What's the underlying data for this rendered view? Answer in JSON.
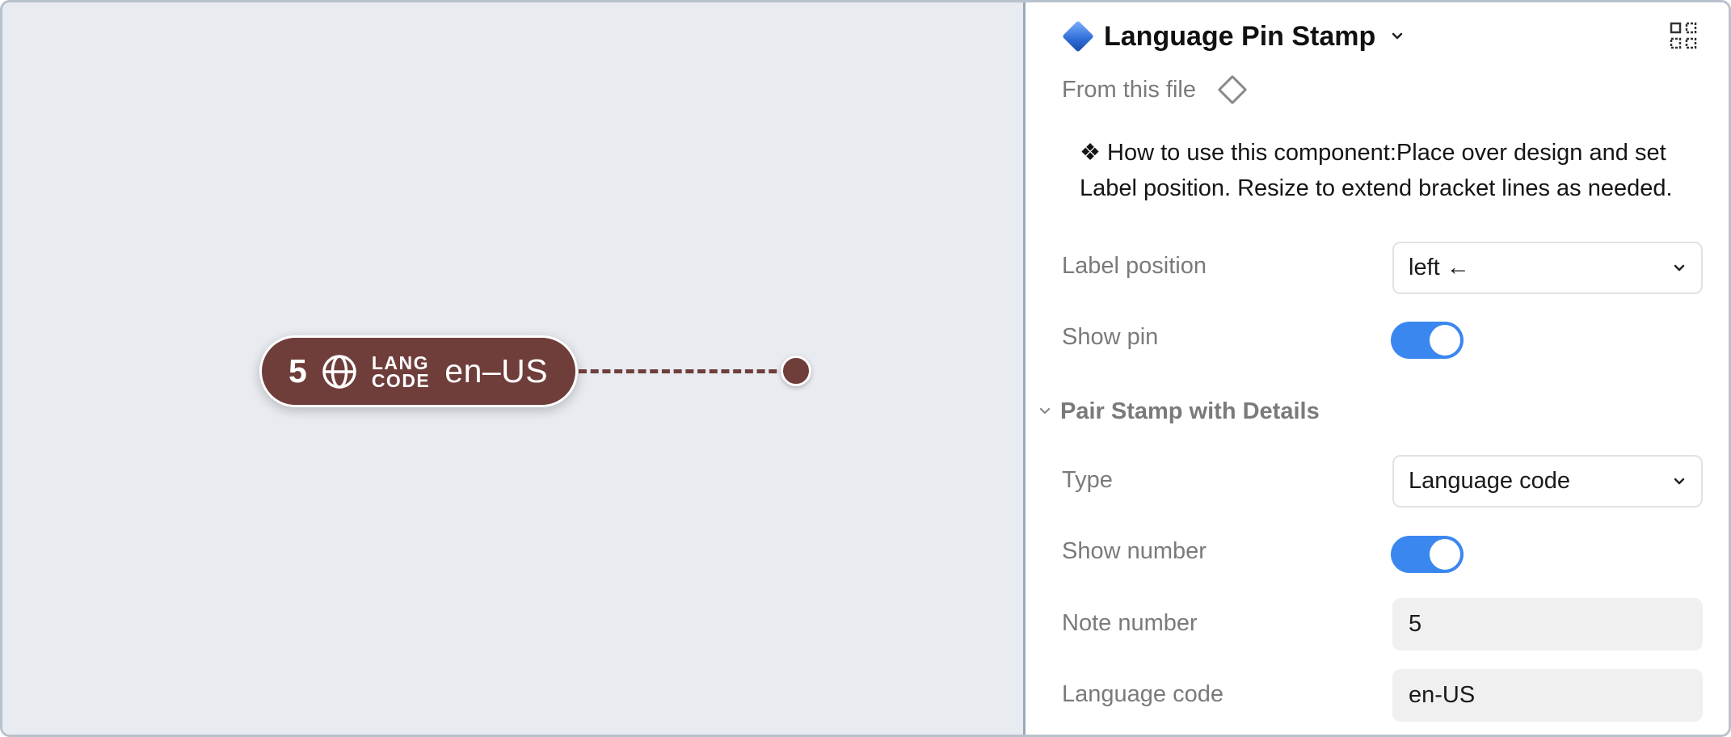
{
  "canvas": {
    "stamp": {
      "number": "5",
      "globe_icon": "globe-icon",
      "tag_line1": "LANG",
      "tag_line2": "CODE",
      "code": "en–US"
    }
  },
  "panel": {
    "component_title": "Language Pin Stamp",
    "component_icon": "blue-diamond-icon",
    "from_file": "From this file",
    "description_line1": "❖ How to use this component:Place over design and set",
    "description_line2": "Label position. Resize to extend bracket lines as needed.",
    "properties": {
      "label_position": {
        "label": "Label position",
        "value": "left ←"
      },
      "show_pin": {
        "label": "Show pin",
        "on": true
      },
      "section_title": "Pair Stamp with Details",
      "type": {
        "label": "Type",
        "value": "Language code"
      },
      "show_number": {
        "label": "Show number",
        "on": true
      },
      "note_number": {
        "label": "Note number",
        "value": "5"
      },
      "language_code": {
        "label": "Language code",
        "value": "en-US"
      }
    }
  },
  "colors": {
    "stamp_fill": "#6f3d3a",
    "toggle_on": "#3b87f0",
    "canvas_bg": "#e8ebf0"
  }
}
